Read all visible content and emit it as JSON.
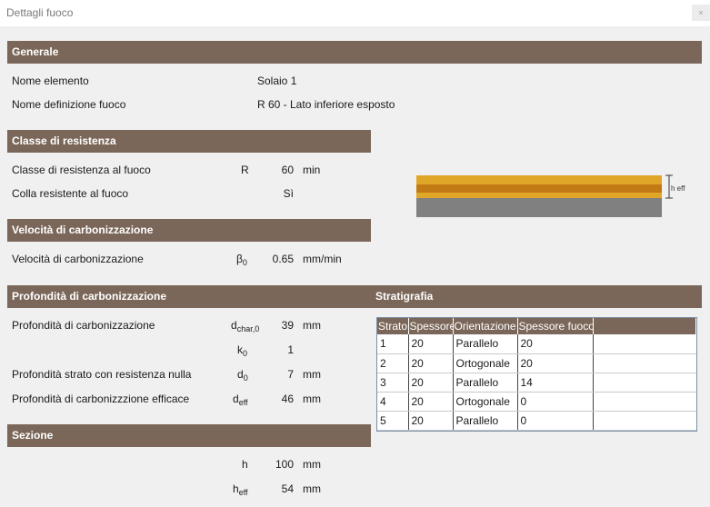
{
  "window": {
    "title": "Dettagli fuoco",
    "close_label": "×"
  },
  "colors": {
    "section_header": "#7b6759",
    "wood_layer": "#e0a628",
    "wood_dark": "#c27a14",
    "char_gray": "#808080"
  },
  "generale": {
    "header": "Generale",
    "nome_elemento_label": "Nome elemento",
    "nome_elemento_value": "Solaio 1",
    "nome_def_label": "Nome definizione fuoco",
    "nome_def_value": "R 60 - Lato inferiore esposto"
  },
  "classe": {
    "header": "Classe di resistenza",
    "classe_label": "Classe di resistenza al fuoco",
    "classe_symbol": "R",
    "classe_value": "60",
    "classe_unit": "min",
    "colla_label": "Colla resistente al fuoco",
    "colla_value": "Sì"
  },
  "velocita": {
    "header": "Velocità di carbonizzazione",
    "label": "Velocità di carbonizzazione",
    "symbol_main": "β",
    "symbol_sub": "0",
    "value": "0.65",
    "unit": "mm/min"
  },
  "profondita": {
    "header": "Profondità di carbonizzazione",
    "dchar_label": "Profondità di carbonizzazione",
    "dchar_sym": "d",
    "dchar_sub": "char,0",
    "dchar_value": "39",
    "dchar_unit": "mm",
    "k0_sym": "k",
    "k0_sub": "0",
    "k0_value": "1",
    "d0_label": "Profondità strato con resistenza nulla",
    "d0_sym": "d",
    "d0_sub": "0",
    "d0_value": "7",
    "d0_unit": "mm",
    "deff_label": "Profondità di carbonizzzione efficace",
    "deff_sym": "d",
    "deff_sub": "eff",
    "deff_value": "46",
    "deff_unit": "mm"
  },
  "sezione": {
    "header": "Sezione",
    "h_sym": "h",
    "h_value": "100",
    "h_unit": "mm",
    "heff_sym": "h",
    "heff_sub": "eff",
    "heff_value": "54",
    "heff_unit": "mm"
  },
  "diagram": {
    "heff_label": "h eff"
  },
  "stratigrafia": {
    "header": "Stratigrafia",
    "columns": [
      "Strato",
      "Spessore",
      "Orientazione",
      "Spessore fuoco",
      ""
    ],
    "rows": [
      [
        "1",
        "20",
        "Parallelo",
        "20",
        ""
      ],
      [
        "2",
        "20",
        "Ortogonale",
        "20",
        ""
      ],
      [
        "3",
        "20",
        "Parallelo",
        "14",
        ""
      ],
      [
        "4",
        "20",
        "Ortogonale",
        "0",
        ""
      ],
      [
        "5",
        "20",
        "Parallelo",
        "0",
        ""
      ]
    ]
  }
}
